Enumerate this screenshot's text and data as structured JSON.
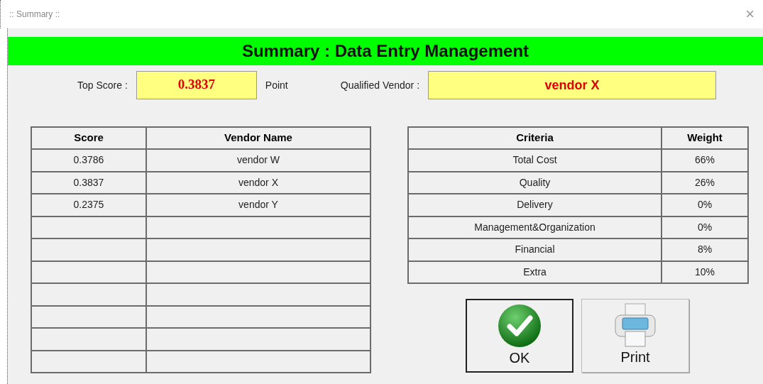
{
  "window": {
    "title": ":: Summary ::",
    "close": "×"
  },
  "banner": "Summary : Data Entry Management",
  "top_score": {
    "label": "Top Score :",
    "value": "0.3837",
    "unit": "Point"
  },
  "qualified_vendor": {
    "label": "Qualified Vendor :",
    "value": "vendor X"
  },
  "scores_table": {
    "columns": [
      "Score",
      "Vendor Name"
    ],
    "rows": [
      [
        "0.3786",
        "vendor W"
      ],
      [
        "0.3837",
        "vendor X"
      ],
      [
        "0.2375",
        "vendor Y"
      ]
    ]
  },
  "criteria_table": {
    "columns": [
      "Criteria",
      "Weight"
    ],
    "rows": [
      [
        "Total Cost",
        "66%"
      ],
      [
        "Quality",
        "26%"
      ],
      [
        "Delivery",
        "0%"
      ],
      [
        "Management&Organization",
        "0%"
      ],
      [
        "Financial",
        "8%"
      ],
      [
        "Extra",
        "10%"
      ]
    ]
  },
  "buttons": [
    {
      "kind": "ok",
      "label": "OK",
      "default": true
    },
    {
      "kind": "print",
      "label": "Print",
      "default": false
    }
  ]
}
